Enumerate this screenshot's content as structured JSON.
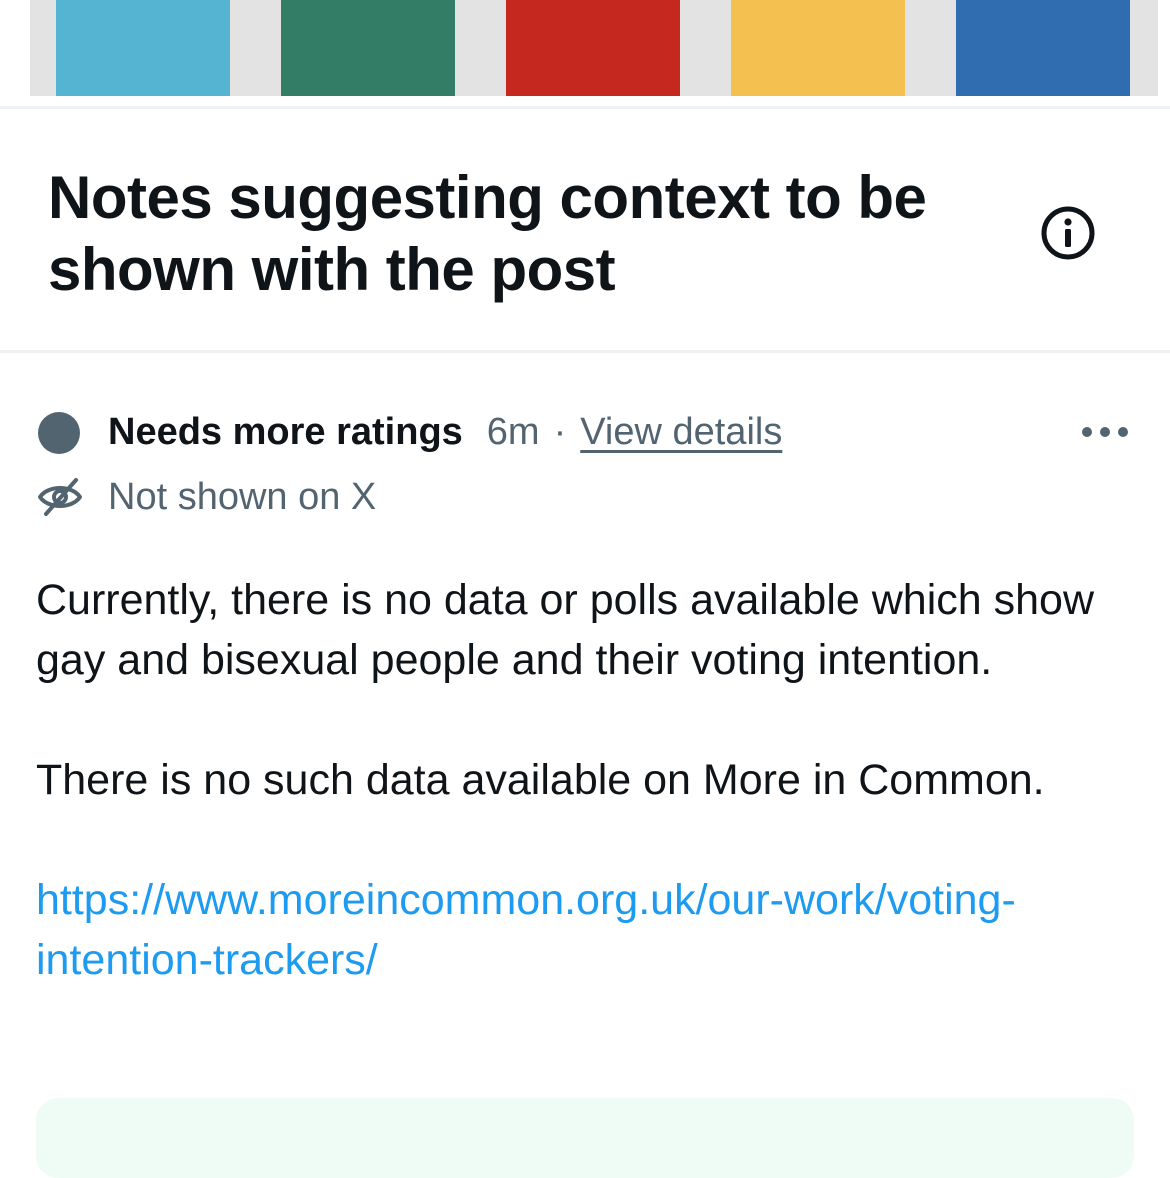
{
  "chart_strip": {
    "colors": [
      "#56b4d3",
      "#337c66",
      "#c4281f",
      "#f4c150",
      "#2f6db0"
    ]
  },
  "header": {
    "title": "Notes suggesting context to be shown with the post",
    "info_icon": "info-circle-icon"
  },
  "note": {
    "status": "Needs more ratings",
    "time": "6m",
    "separator": "·",
    "view_details": "View details",
    "more_icon": "more-horizontal-icon",
    "visibility_icon": "eye-slash-icon",
    "visibility": "Not shown on X",
    "paragraphs": [
      "Currently, there is no data or polls available which show gay and bisexual people and their voting intention.",
      "There is no such data available on More in Common."
    ],
    "link": "https://www.moreincommon.org.uk/our-work/voting-intention-trackers/"
  },
  "colors": {
    "primary_text": "#0f1419",
    "secondary_text": "#536471",
    "link": "#1d9bf0",
    "status_dot": "#536471",
    "rating_box": "#effcf6"
  }
}
